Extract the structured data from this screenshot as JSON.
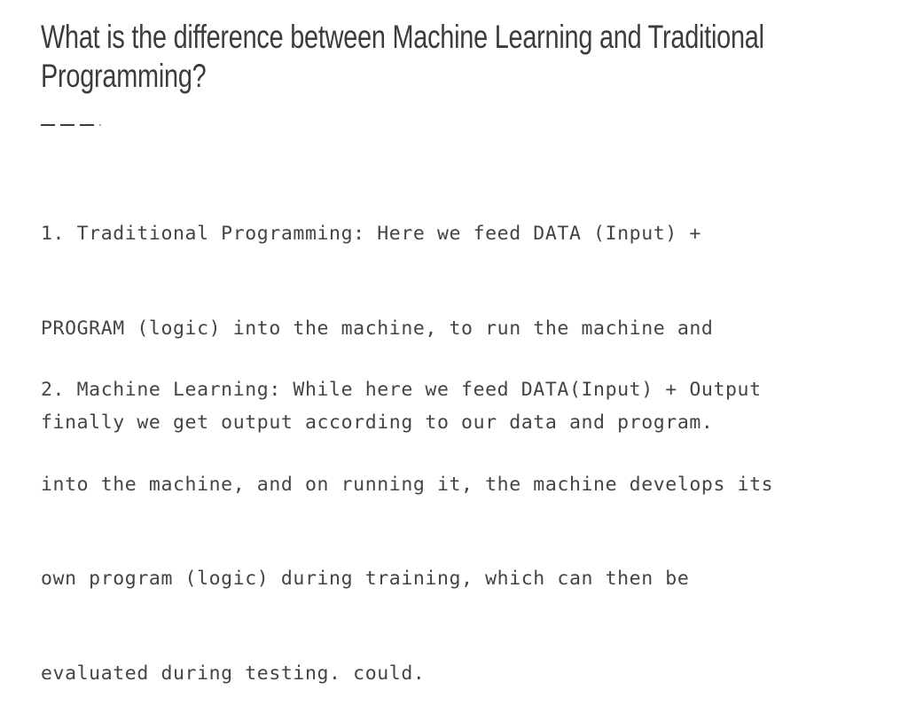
{
  "slide": {
    "title": "What is the difference between Machine Learning and Traditional Programming?",
    "title_lines": [
      "What is the difference between Machine Learning and Traditional",
      "Programming?"
    ],
    "paragraphs": [
      {
        "lines": [
          "1. Traditional Programming: Here we feed DATA (Input) +",
          "PROGRAM (logic) into the machine, to run the machine and",
          "finally we get output according to our data and program."
        ]
      },
      {
        "lines": [
          "2. Machine Learning: While here we feed DATA(Input) + Output",
          "into the machine, and on running it, the machine develops its",
          "own program (logic) during training, which can then be",
          "evaluated during testing. could."
        ]
      }
    ]
  },
  "colors": {
    "background": "#ffffff",
    "text": "#444444",
    "title": "#3c3c3c"
  }
}
